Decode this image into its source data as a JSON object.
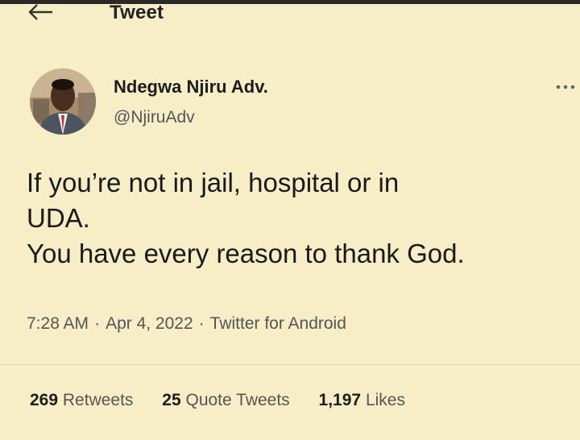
{
  "header": {
    "title": "Tweet",
    "back_icon": "arrow-left-icon"
  },
  "author": {
    "name": "Ndegwa Njiru Adv.",
    "handle": "@NjiruAdv",
    "avatar": "avatar-photo"
  },
  "more_icon": "more-options-icon",
  "tweet": {
    "text": "If you’re not in jail, hospital or in\nUDA.\nYou have every reason to thank God."
  },
  "meta": {
    "time": "7:28 AM",
    "date": "Apr 4, 2022",
    "source": "Twitter for Android",
    "separator": "·"
  },
  "stats": {
    "retweets_count": "269",
    "retweets_label": "Retweets",
    "quotes_count": "25",
    "quotes_label": "Quote Tweets",
    "likes_count": "1,197",
    "likes_label": "Likes"
  },
  "colors": {
    "background": "#f7eec8",
    "text": "#1a1a1a",
    "secondary_text": "#555555"
  }
}
